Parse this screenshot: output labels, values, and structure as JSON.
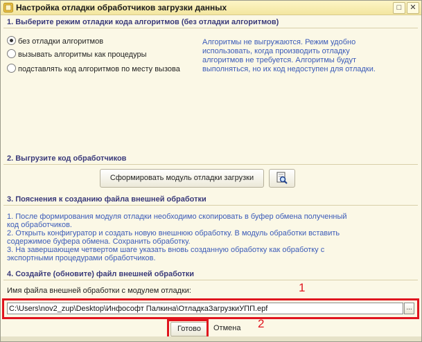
{
  "window": {
    "title": "Настройка отладки обработчиков загрузки данных",
    "controls": {
      "maximize": "□",
      "close": "✕"
    }
  },
  "section1": {
    "header": "1. Выберите режим отладки кода алгоритмов (без отладки алгоритмов)",
    "options": [
      {
        "label": "без отладки алгоритмов",
        "selected": true
      },
      {
        "label": "вызывать алгоритмы как процедуры",
        "selected": false
      },
      {
        "label": "подставлять код алгоритмов по месту вызова",
        "selected": false
      }
    ],
    "info": "Алгоритмы не выгружаются. Режим удобно использовать, когда производить отладку алгоритмов не требуется. Алгоритмы будут выполняться, но их код недоступен для отладки."
  },
  "section2": {
    "header": "2. Выгрузите код обработчиков",
    "generate_button": "Сформировать модуль отладки загрузки",
    "view_icon": "magnifier-document-icon"
  },
  "section3": {
    "header": "3. Пояснения к созданию файла внешней обработки",
    "notes": [
      "1. После формирования модуля отладки необходимо скопировать в буфер обмена полученный",
      "код обработчиков.",
      "2. Открыть конфигуратор и создать новую внешнюю обработку. В модуль обработки вставить",
      "содержимое буфера обмена. Сохранить обработку.",
      "3. На завершающем четвертом шаге указать вновь созданную обработку как обработку с",
      "экспортными процедурами обработчиков."
    ]
  },
  "section4": {
    "header": "4. Создайте (обновите) файл внешней обработки",
    "file_label": "Имя файла внешней обработки с модулем отладки:",
    "file_path": "C:\\Users\\nov2_zup\\Desktop\\Инфософт Палкина\\ОтладкаЗагрузкиУПП.epf",
    "browse_button": "..."
  },
  "footer": {
    "ok_button": "Готово",
    "cancel_button": "Отмена"
  },
  "annotations": {
    "marker1": "1",
    "marker2": "2",
    "color": "#e0141e"
  }
}
